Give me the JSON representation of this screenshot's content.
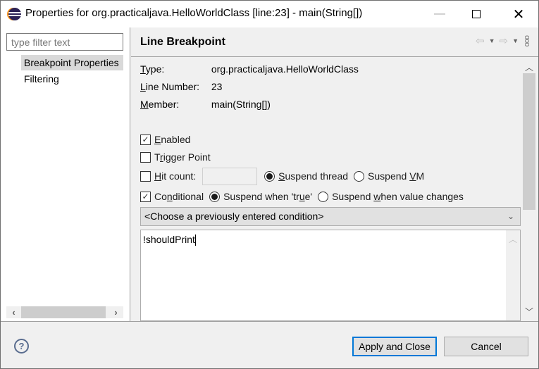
{
  "window": {
    "title": "Properties for org.practicaljava.HelloWorldClass [line:23] - main(String[])",
    "controls": {
      "minimize": "—",
      "maximize": "",
      "close": "✕"
    }
  },
  "left_pane": {
    "filter_placeholder": "type filter text",
    "filter_value": "",
    "tree_items": [
      {
        "label": "Breakpoint Properties",
        "selected": true
      },
      {
        "label": "Filtering",
        "selected": false
      }
    ],
    "scroll_left": "‹",
    "scroll_right": "›"
  },
  "page": {
    "title": "Line Breakpoint",
    "nav": {
      "back": "⇦",
      "back_menu": "▼",
      "forward": "⇨",
      "forward_menu": "▼",
      "view_menu": "ooo"
    },
    "properties": [
      {
        "label_mnemonic": "T",
        "label_rest": "ype:",
        "value": "org.practicaljava.HelloWorldClass"
      },
      {
        "label_mnemonic": "L",
        "label_rest": "ine Number:",
        "value": "23"
      },
      {
        "label_mnemonic": "M",
        "label_rest": "ember:",
        "value": "main(String[])"
      }
    ],
    "enabled": {
      "pre": "",
      "mn": "E",
      "post": "nabled",
      "checked": true
    },
    "trigger_point": {
      "pre": "T",
      "mn": "r",
      "post": "igger Point",
      "checked": false
    },
    "hit_count": {
      "pre": "",
      "mn": "H",
      "post": "it count:",
      "checked": false,
      "value": "",
      "suspend_thread": {
        "pre": "",
        "mn": "S",
        "post": "uspend thread",
        "selected": true
      },
      "suspend_vm": {
        "pre": "Suspend ",
        "mn": "V",
        "post": "M",
        "selected": false
      }
    },
    "conditional": {
      "pre": "Co",
      "mn": "n",
      "post": "ditional",
      "checked": true,
      "when_true": {
        "pre": "Suspend when 'tr",
        "mn": "u",
        "post": "e'",
        "selected": true
      },
      "when_changes": {
        "pre": "Suspend ",
        "mn": "w",
        "post": "hen value changes",
        "selected": false
      }
    },
    "condition_history": "<Choose a previously entered condition>",
    "condition_text": "!shouldPrint"
  },
  "buttons": {
    "help": "?",
    "apply_close": "Apply and Close",
    "cancel": "Cancel"
  },
  "colors": {
    "accent_focus": "#0078d7",
    "selection": "#d9d9d9",
    "pane_bg": "#f0f0f0"
  }
}
